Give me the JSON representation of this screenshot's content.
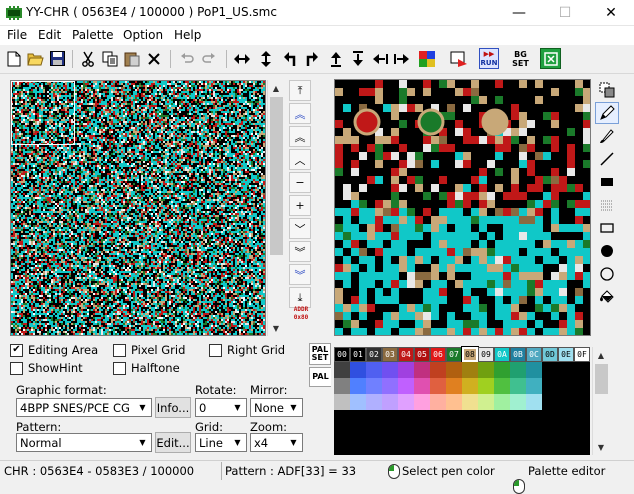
{
  "window": {
    "title": "YY-CHR ( 0563E4 / 100000 ) PoP1_US.smc",
    "minimize_glyph": "—",
    "maximize_glyph": "☐",
    "close_glyph": "✕"
  },
  "menu": [
    {
      "label": "File"
    },
    {
      "label": "Edit"
    },
    {
      "label": "Palette"
    },
    {
      "label": "Option"
    },
    {
      "label": "Help"
    }
  ],
  "toolbar": {
    "new": "new-file-icon",
    "open": "open-folder-icon",
    "save": "save-disk-icon",
    "cut": "cut-icon",
    "copy": "copy-icon",
    "paste": "paste-icon",
    "delete": "delete-x-icon",
    "undo": "undo-icon",
    "redo": "redo-icon",
    "flip_h": "flip-horizontal-icon",
    "flip_v": "flip-vertical-icon",
    "rotate_l": "rotate-left-icon",
    "rotate_r": "rotate-right-icon",
    "shift_up": "shift-up-icon",
    "shift_down": "shift-down-icon",
    "shift_left": "shift-left-icon",
    "shift_right": "shift-right-icon",
    "replace_color": "replace-color-icon",
    "png_export": "export-icon",
    "run_label": "RUN",
    "bg_set_label_1": "BG",
    "bg_set_label_2": "SET",
    "exit": "exit-icon"
  },
  "nav_buttons": {
    "addr_label_1": "ADDR",
    "addr_label_2": "0x80"
  },
  "options": {
    "editing_area": {
      "label": "Editing Area",
      "checked": true
    },
    "pixel_grid": {
      "label": "Pixel Grid",
      "checked": false
    },
    "right_grid": {
      "label": "Right Grid",
      "checked": false
    },
    "show_hint": {
      "label": "ShowHint",
      "checked": false
    },
    "halftone": {
      "label": "Halftone",
      "checked": false
    }
  },
  "graphic_format": {
    "label": "Graphic format:",
    "value": "4BPP SNES/PCE CG",
    "info_button": "Info..."
  },
  "rotate": {
    "label": "Rotate:",
    "value": "0"
  },
  "mirror": {
    "label": "Mirror:",
    "value": "None"
  },
  "pattern": {
    "label": "Pattern:",
    "value": "Normal",
    "edit_button": "Edit..."
  },
  "grid": {
    "label": "Grid:",
    "value": "Line"
  },
  "zoom": {
    "label": "Zoom:",
    "value": "x4"
  },
  "palette_panel": {
    "tab_pal_set_1": "PAL",
    "tab_pal_set_2": "SET",
    "tab_pal": "PAL",
    "indices": [
      "00",
      "01",
      "02",
      "03",
      "04",
      "05",
      "06",
      "07",
      "08",
      "09",
      "0A",
      "0B",
      "0C",
      "0D",
      "0E",
      "0F"
    ],
    "index_colors": [
      "#000000",
      "#000000",
      "#303030",
      "#8a6a40",
      "#c01818",
      "#b01010",
      "#e01818",
      "#1a7a2a",
      "#c8a878",
      "#e8e8e8",
      "#10c8c8",
      "#2080a0",
      "#50a8c0",
      "#70c8d8",
      "#a0e0f0",
      "#ffffff"
    ],
    "selected_index": "08",
    "palette_rows": [
      [
        "#404040",
        "#3050e0",
        "#5060f0",
        "#7050f0",
        "#a040e0",
        "#c03080",
        "#c04020",
        "#b06010",
        "#a08010",
        "#70a010",
        "#30a030",
        "#20a070",
        "#2090a0"
      ],
      [
        "#808080",
        "#5080ff",
        "#7080ff",
        "#9070ff",
        "#c060ff",
        "#e050b0",
        "#e06040",
        "#e08020",
        "#d0b020",
        "#a0d020",
        "#50c040",
        "#40c090",
        "#40b0c0"
      ],
      [
        "#c0c0c0",
        "#a0c0ff",
        "#b0b0ff",
        "#c0a0ff",
        "#e0a0ff",
        "#ffa0e0",
        "#ffb0a0",
        "#ffc090",
        "#f0e090",
        "#d0f090",
        "#a0f0a0",
        "#a0f0d0",
        "#a0e0f0"
      ]
    ]
  },
  "side_tools": [
    {
      "name": "select-tool-icon"
    },
    {
      "name": "pen-tool-icon"
    },
    {
      "name": "brush-tool-icon"
    },
    {
      "name": "line-tool-icon"
    },
    {
      "name": "filled-rect-tool-icon"
    },
    {
      "name": "pattern-tool-icon"
    },
    {
      "name": "rect-tool-icon"
    },
    {
      "name": "filled-circle-tool-icon"
    },
    {
      "name": "circle-tool-icon"
    },
    {
      "name": "fill-bucket-tool-icon"
    }
  ],
  "status": {
    "chr": "CHR : 0563E4 - 0583E3 / 100000",
    "pattern": "Pattern : ADF[33] = 33",
    "select_pen": "Select pen color",
    "palette_editor": "Palette editor"
  },
  "colors": {
    "tile_palette": [
      "#000000",
      "#10c8c8",
      "#c01818",
      "#1a7a2a",
      "#c8a878",
      "#e8e8e8",
      "#8a6a40",
      "#ffffff"
    ],
    "accent": "#2a9a2a"
  }
}
